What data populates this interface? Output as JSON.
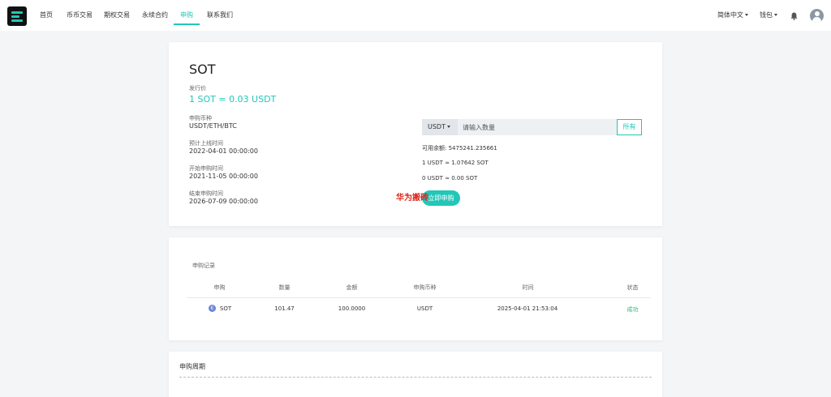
{
  "nav": {
    "items": [
      "首页",
      "币币交易",
      "期权交易",
      "永续合约",
      "申购",
      "联系我们"
    ],
    "language": "简体中文",
    "wallet": "钱包"
  },
  "colors": {
    "accent": "#22c7b8",
    "success": "#2bb673",
    "watermark": "#e0251b"
  },
  "icons": [
    "logo-icon",
    "bell-icon",
    "avatar-icon",
    "caret-down-icon",
    "eth-coin-icon"
  ],
  "subscription": {
    "coin": "SOT",
    "price_label": "发行价",
    "price": "1 SOT = 0.03 USDT",
    "currency_label": "申购币种",
    "currency": "USDT/ETH/BTC",
    "listing_label": "预计上线时间",
    "listing_time": "2022-04-01 00:00:00",
    "start_label": "开始申购时间",
    "start_time": "2021-11-05 00:00:00",
    "end_label": "结束申购时间",
    "end_time": "2026-07-09 00:00:00"
  },
  "form": {
    "currency_selected": "USDT",
    "amount_placeholder": "请输入数量",
    "all_button": "所有",
    "balance": "可用余额: 5475241.235661",
    "rate": "1 USDT ≈ 1.07642 SOT",
    "estimate": "0 USDT ≈ 0.00 SOT",
    "submit": "立即申购"
  },
  "watermark": "华为搬砖",
  "records": {
    "title": "申购记录",
    "columns": [
      "申购",
      "数量",
      "金额",
      "申购币种",
      "时间",
      "状态"
    ],
    "rows": [
      {
        "coin_icon": "€",
        "coin": "SOT",
        "quantity": "101.47",
        "amount": "100.0000",
        "currency": "USDT",
        "time": "2025-04-01 21:53:04",
        "status": "成功"
      }
    ]
  },
  "period": {
    "title": "申购周期"
  }
}
